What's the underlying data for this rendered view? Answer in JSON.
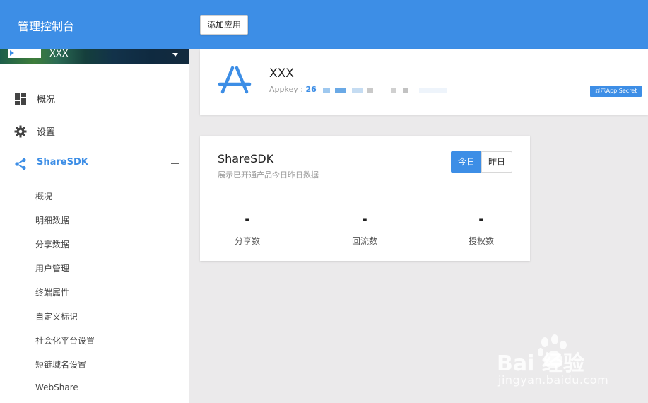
{
  "header": {
    "title": "管理控制台",
    "add_app_label": "添加应用"
  },
  "sidebar": {
    "user_name": "XXX",
    "nav": [
      {
        "label": "概况",
        "icon": "dashboard-icon"
      },
      {
        "label": "设置",
        "icon": "gear-icon"
      },
      {
        "label": "ShareSDK",
        "icon": "share-icon",
        "active": true,
        "expanded": true
      }
    ],
    "sub_items": [
      "概况",
      "明细数据",
      "分享数据",
      "用户管理",
      "终端属性",
      "自定义标识",
      "社会化平台设置",
      "短链域名设置",
      "WebShare"
    ]
  },
  "app": {
    "name": "XXX",
    "appkey_label": "Appkey : ",
    "appkey_visible": "26",
    "show_secret_label": "显示App Secret",
    "icon": "app-store-icon"
  },
  "stats": {
    "title": "ShareSDK",
    "subtitle": "展示已开通产品今日昨日数据",
    "tab_today": "今日",
    "tab_yesterday": "昨日",
    "active_tab": "今日",
    "metrics": [
      {
        "value": "-",
        "label": "分享数"
      },
      {
        "value": "-",
        "label": "回流数"
      },
      {
        "value": "-",
        "label": "授权数"
      }
    ]
  },
  "watermark": {
    "main": "Bai 经验",
    "sub": "jingyan.baidu.com"
  },
  "colors": {
    "brand": "#3d8ee6",
    "background": "#ebeaeb"
  }
}
